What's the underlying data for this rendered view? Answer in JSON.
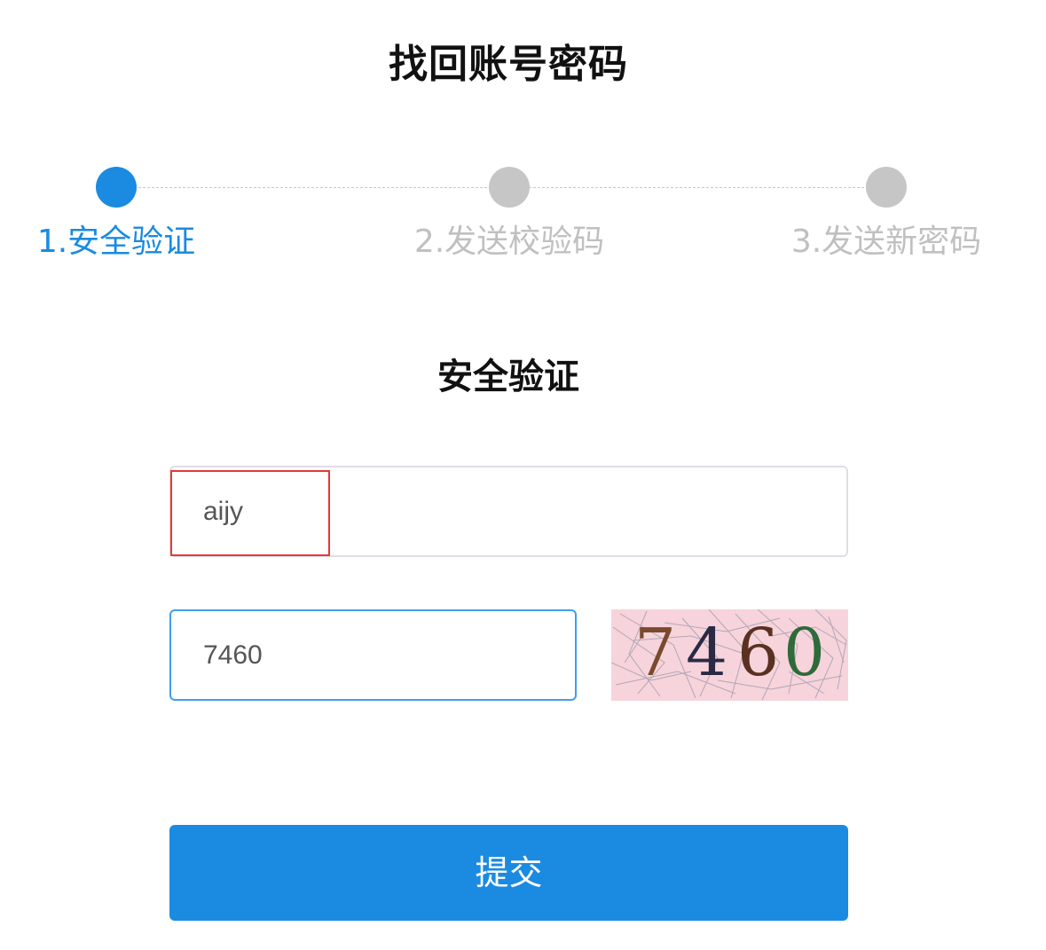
{
  "page": {
    "title": "找回账号密码"
  },
  "steps": [
    {
      "label": "1.安全验证",
      "state": "active"
    },
    {
      "label": "2.发送校验码",
      "state": "inactive"
    },
    {
      "label": "3.发送新密码",
      "state": "inactive"
    }
  ],
  "form": {
    "section_title": "安全验证",
    "username_value": "aijy",
    "captcha_input_value": "7460",
    "captcha_image": {
      "digits": [
        "7",
        "4",
        "6",
        "0"
      ],
      "digit_colors": [
        "#7a4a2e",
        "#2a2a44",
        "#5a3020",
        "#2f6a3a"
      ],
      "background_color": "#f7d3dc"
    },
    "submit_label": "提交"
  },
  "colors": {
    "accent": "#1a8be0",
    "inactive": "#c6c6c6",
    "highlight": "#e53935"
  }
}
